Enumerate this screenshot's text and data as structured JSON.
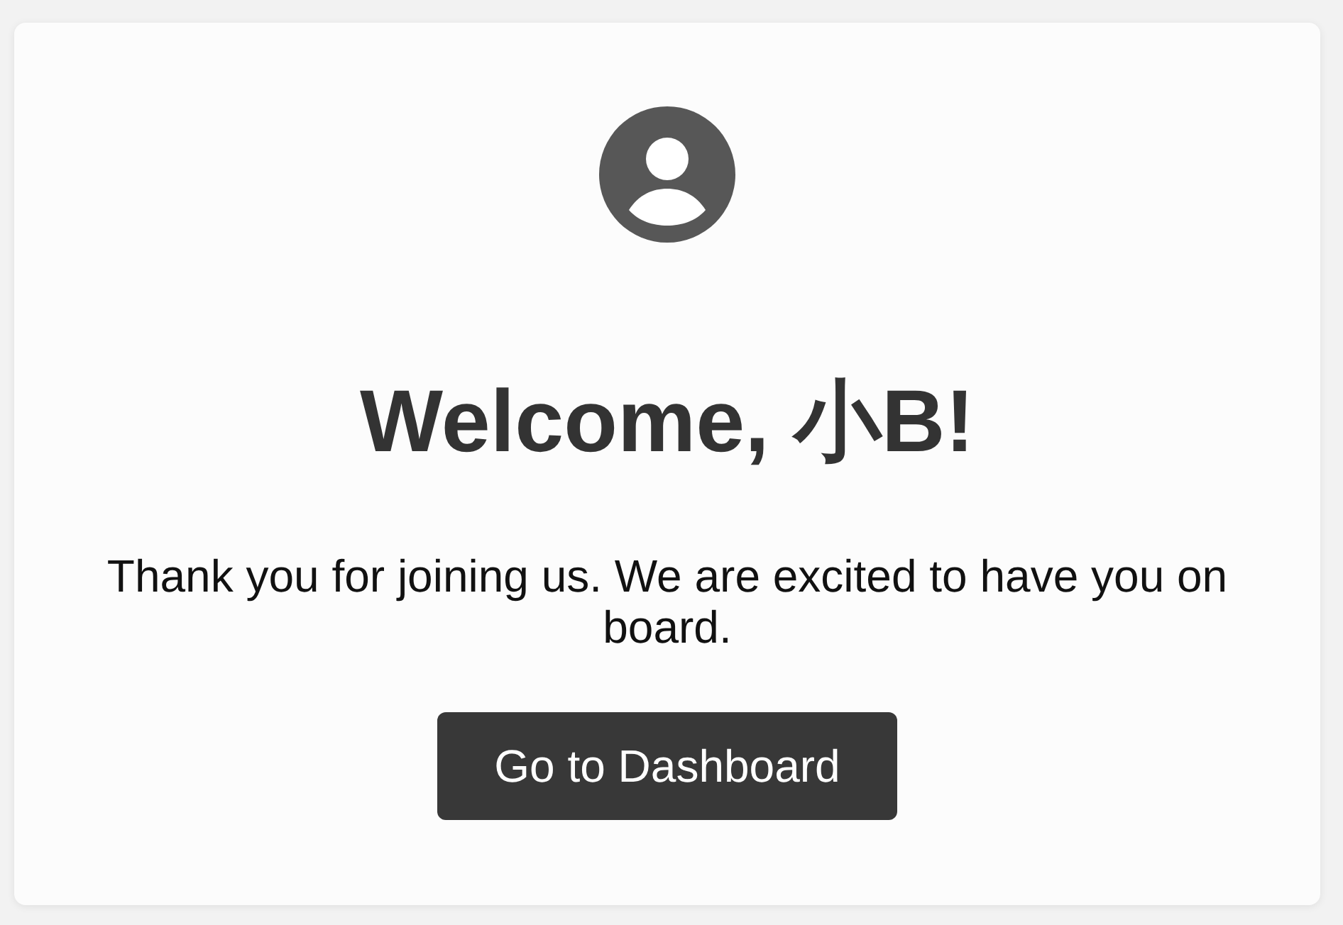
{
  "heading": "Welcome, 小B!",
  "message": "Thank you for joining us. We are excited to have you on board.",
  "button": {
    "label": "Go to Dashboard"
  }
}
